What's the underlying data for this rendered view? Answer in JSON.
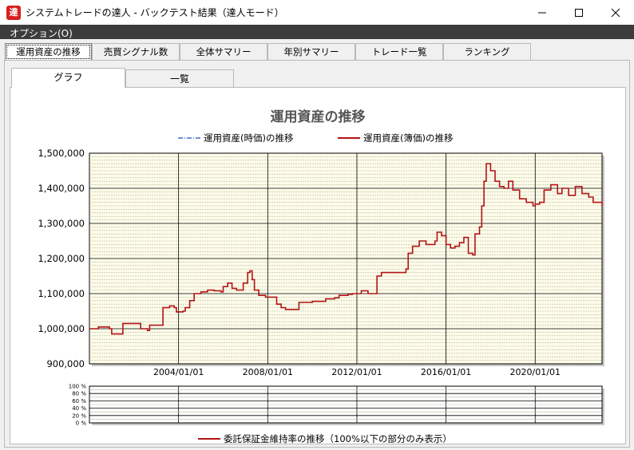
{
  "window": {
    "title": "システムトレードの達人 - バックテスト結果（達人モード）",
    "app_icon_glyph": "達",
    "minimize_icon": "minimize-icon",
    "maximize_icon": "maximize-icon",
    "close_icon": "close-icon"
  },
  "menu": {
    "options_label": "オプション(O)"
  },
  "main_tabs": [
    {
      "label": "運用資産の推移",
      "active": true
    },
    {
      "label": "売買シグナル数",
      "active": false
    },
    {
      "label": "全体サマリー",
      "active": false
    },
    {
      "label": "年別サマリー",
      "active": false
    },
    {
      "label": "トレード一覧",
      "active": false
    },
    {
      "label": "ランキング",
      "active": false
    }
  ],
  "sub_tabs": [
    {
      "label": "グラフ",
      "active": true
    },
    {
      "label": "一覧",
      "active": false
    }
  ],
  "colors": {
    "plot_background": "#fdfbe9",
    "book_value_line": "#b01515",
    "market_value_line": "#3b6fc4",
    "title_color": "#555555"
  },
  "chart_data": [
    {
      "type": "line",
      "title": "運用資産の推移",
      "legend": [
        {
          "name": "運用資産(時価)の推移",
          "style": "dash-dot",
          "color": "#3b6fc4"
        },
        {
          "name": "運用資産(簿価)の推移",
          "style": "solid",
          "color": "#b01515"
        }
      ],
      "legend_position": "top-center",
      "ylim": [
        900000,
        1500000
      ],
      "y_ticks": [
        "1,500,000",
        "1,400,000",
        "1,300,000",
        "1,200,000",
        "1,100,000",
        "1,000,000",
        "900,000"
      ],
      "x_ticks": [
        "2004/01/01",
        "2008/01/01",
        "2012/01/01",
        "2016/01/01",
        "2020/01/01"
      ],
      "xlim_year": [
        2000.0,
        2023.0
      ],
      "grid": true,
      "series": [
        {
          "name": "運用資産(簿価)の推移",
          "points": [
            [
              2000.0,
              1000000
            ],
            [
              2000.4,
              1005000
            ],
            [
              2000.9,
              1000000
            ],
            [
              2001.0,
              985000
            ],
            [
              2001.4,
              985000
            ],
            [
              2001.5,
              1015000
            ],
            [
              2002.2,
              1015000
            ],
            [
              2002.3,
              1000000
            ],
            [
              2002.6,
              995000
            ],
            [
              2002.7,
              1010000
            ],
            [
              2003.2,
              1010000
            ],
            [
              2003.3,
              1060000
            ],
            [
              2003.6,
              1065000
            ],
            [
              2003.8,
              1060000
            ],
            [
              2003.9,
              1048000
            ],
            [
              2004.2,
              1050000
            ],
            [
              2004.3,
              1060000
            ],
            [
              2004.5,
              1080000
            ],
            [
              2004.7,
              1100000
            ],
            [
              2005.0,
              1105000
            ],
            [
              2005.3,
              1110000
            ],
            [
              2005.6,
              1108000
            ],
            [
              2005.9,
              1105000
            ],
            [
              2006.0,
              1120000
            ],
            [
              2006.2,
              1130000
            ],
            [
              2006.4,
              1115000
            ],
            [
              2006.6,
              1110000
            ],
            [
              2006.9,
              1130000
            ],
            [
              2007.1,
              1160000
            ],
            [
              2007.2,
              1165000
            ],
            [
              2007.3,
              1140000
            ],
            [
              2007.4,
              1110000
            ],
            [
              2007.6,
              1095000
            ],
            [
              2007.9,
              1090000
            ],
            [
              2008.2,
              1090000
            ],
            [
              2008.4,
              1070000
            ],
            [
              2008.6,
              1060000
            ],
            [
              2008.8,
              1055000
            ],
            [
              2009.2,
              1055000
            ],
            [
              2009.4,
              1075000
            ],
            [
              2010.0,
              1078000
            ],
            [
              2010.5,
              1078000
            ],
            [
              2010.6,
              1085000
            ],
            [
              2011.0,
              1088000
            ],
            [
              2011.2,
              1095000
            ],
            [
              2011.6,
              1098000
            ],
            [
              2011.8,
              1100000
            ],
            [
              2012.0,
              1100000
            ],
            [
              2012.2,
              1108000
            ],
            [
              2012.5,
              1100000
            ],
            [
              2012.8,
              1100000
            ],
            [
              2012.9,
              1150000
            ],
            [
              2013.1,
              1160000
            ],
            [
              2013.6,
              1160000
            ],
            [
              2014.1,
              1160000
            ],
            [
              2014.2,
              1170000
            ],
            [
              2014.3,
              1215000
            ],
            [
              2014.5,
              1235000
            ],
            [
              2014.8,
              1250000
            ],
            [
              2015.1,
              1240000
            ],
            [
              2015.5,
              1250000
            ],
            [
              2015.6,
              1275000
            ],
            [
              2015.8,
              1265000
            ],
            [
              2016.0,
              1240000
            ],
            [
              2016.2,
              1230000
            ],
            [
              2016.4,
              1235000
            ],
            [
              2016.6,
              1245000
            ],
            [
              2016.8,
              1260000
            ],
            [
              2017.0,
              1215000
            ],
            [
              2017.2,
              1210000
            ],
            [
              2017.3,
              1270000
            ],
            [
              2017.5,
              1290000
            ],
            [
              2017.6,
              1350000
            ],
            [
              2017.7,
              1420000
            ],
            [
              2017.8,
              1470000
            ],
            [
              2018.0,
              1450000
            ],
            [
              2018.2,
              1420000
            ],
            [
              2018.4,
              1405000
            ],
            [
              2018.6,
              1400000
            ],
            [
              2018.8,
              1420000
            ],
            [
              2019.0,
              1395000
            ],
            [
              2019.3,
              1370000
            ],
            [
              2019.6,
              1360000
            ],
            [
              2019.9,
              1350000
            ],
            [
              2020.0,
              1355000
            ],
            [
              2020.2,
              1360000
            ],
            [
              2020.4,
              1395000
            ],
            [
              2020.7,
              1410000
            ],
            [
              2021.0,
              1385000
            ],
            [
              2021.2,
              1400000
            ],
            [
              2021.5,
              1380000
            ],
            [
              2021.8,
              1405000
            ],
            [
              2022.1,
              1385000
            ],
            [
              2022.4,
              1375000
            ],
            [
              2022.6,
              1360000
            ],
            [
              2023.0,
              1350000
            ]
          ]
        }
      ]
    },
    {
      "type": "line",
      "title": "",
      "legend": [
        {
          "name": "委託保証金維持率の推移（100%以下の部分のみ表示）",
          "style": "solid",
          "color": "#b01515"
        }
      ],
      "legend_position": "bottom-center",
      "ylim": [
        0,
        100
      ],
      "y_ticks": [
        "100 %",
        "80 %",
        "60 %",
        "40 %",
        "20 %",
        "0 %"
      ],
      "grid": true,
      "series": []
    }
  ]
}
